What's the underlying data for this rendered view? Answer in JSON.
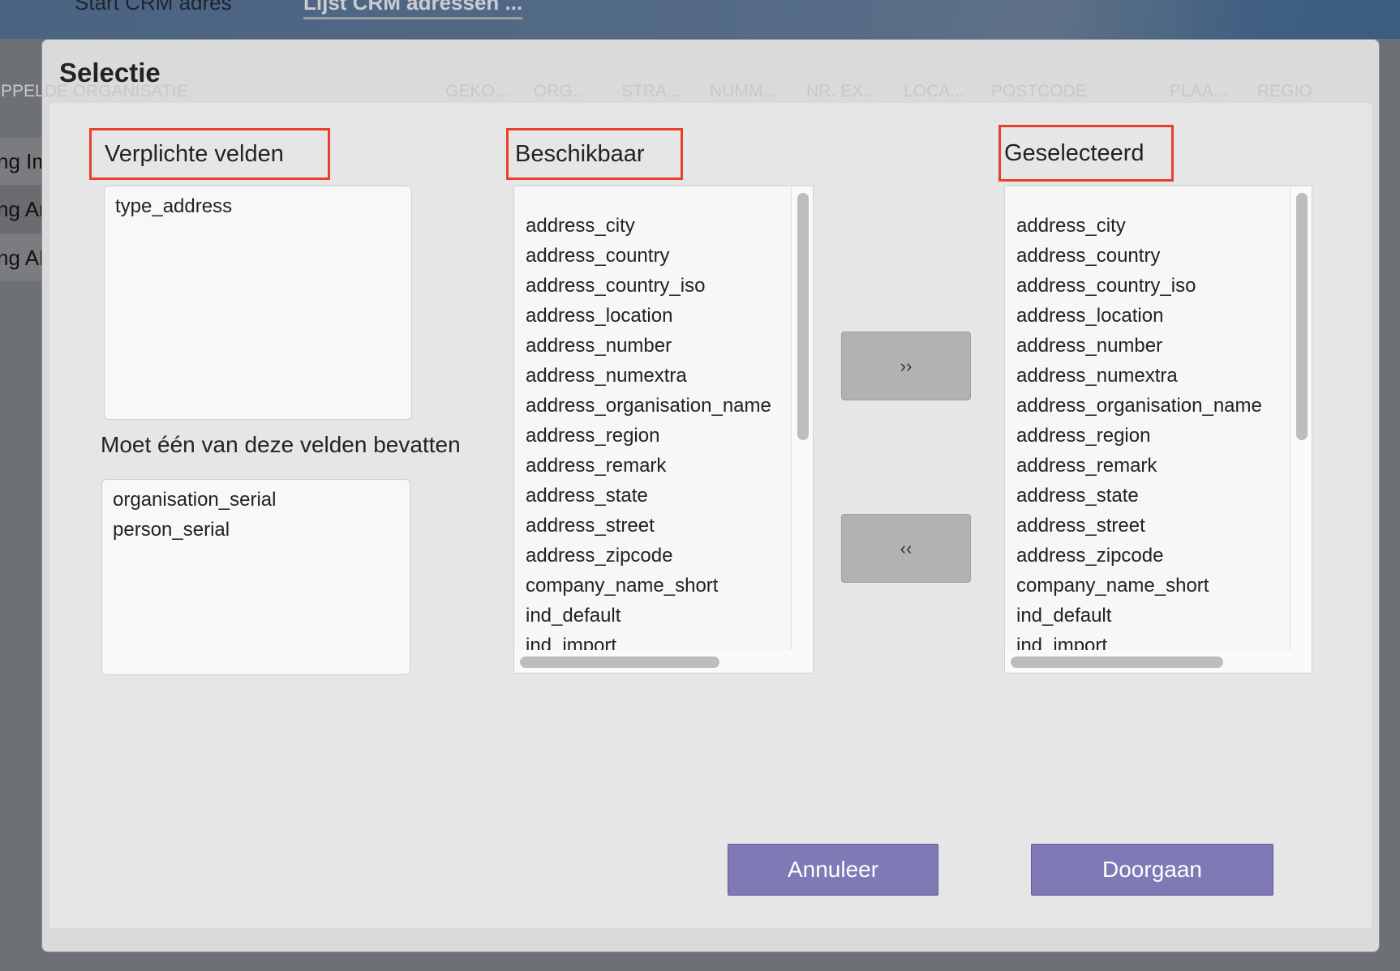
{
  "breadcrumb": {
    "items": [
      "Start CRM adres",
      "Lijst CRM adressen ..."
    ]
  },
  "background": {
    "columns": [
      "PPELDE ORGANISATIE",
      "GEKO...",
      "ORG...",
      "STRA...",
      "NUMM...",
      "NR. EX...",
      "LOCA...",
      "POSTCODE",
      "PLAA...",
      "REGIO"
    ],
    "rows": [
      "ng Im",
      "ng Ar",
      "ng AE"
    ]
  },
  "dialog": {
    "title": "Selectie",
    "required": {
      "label": "Verplichte velden",
      "items": [
        "type_address"
      ]
    },
    "one_of": {
      "label": "Moet één van deze velden bevatten",
      "items": [
        "organisation_serial",
        "person_serial"
      ]
    },
    "available": {
      "label": "Beschikbaar",
      "items": [
        "address_city",
        "address_country",
        "address_country_iso",
        "address_location",
        "address_number",
        "address_numextra",
        "address_organisation_name",
        "address_region",
        "address_remark",
        "address_state",
        "address_street",
        "address_zipcode",
        "company_name_short",
        "ind_default",
        "ind_import"
      ]
    },
    "selected": {
      "label": "Geselecteerd",
      "items": [
        "address_city",
        "address_country",
        "address_country_iso",
        "address_location",
        "address_number",
        "address_numextra",
        "address_organisation_name",
        "address_region",
        "address_remark",
        "address_state",
        "address_street",
        "address_zipcode",
        "company_name_short",
        "ind_default",
        "ind_import"
      ]
    },
    "add_label": "››",
    "remove_label": "‹‹",
    "cancel_label": "Annuleer",
    "continue_label": "Doorgaan"
  },
  "colors": {
    "accent": "#7f79b5",
    "highlight": "#e8402a"
  }
}
